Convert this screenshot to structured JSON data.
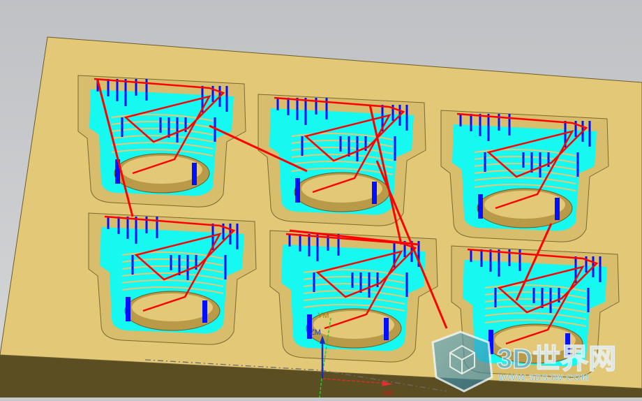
{
  "viewport": {
    "axes": {
      "z_label": "ZM",
      "y_label": "YM",
      "x_label": "XM"
    },
    "colors": {
      "plate": "#e3c878",
      "plate_edge": "#5a4e22",
      "toolpath_rapid": "#ff0000",
      "toolpath_plunge": "#0010ff",
      "toolpath_cut": "#00ffff",
      "background": "#c8c9cc"
    }
  },
  "watermark": {
    "title": "3D世界网",
    "url": "WWW.3DSJW.COM"
  }
}
